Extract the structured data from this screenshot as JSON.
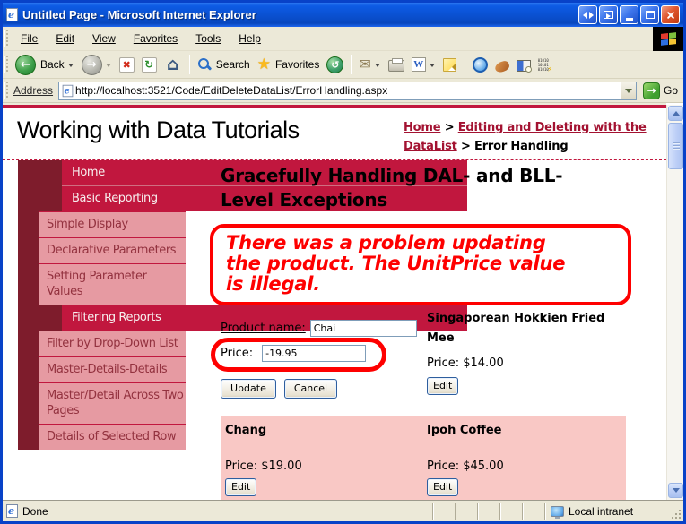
{
  "colors": {
    "crimson": "#C1173E",
    "maroon": "#7E1C2C",
    "side-pink": "#E69AA2",
    "side-sub-text": "#93323F",
    "row-pink": "#F9C8C5",
    "annotation-red": "#FE0000",
    "link-maroon": "#A31231",
    "chrome-beige": "#ECE9D8",
    "xp-border-blue": "#0842C8"
  },
  "window": {
    "title": "Untitled Page - Microsoft Internet Explorer"
  },
  "menu": {
    "items": [
      "File",
      "Edit",
      "View",
      "Favorites",
      "Tools",
      "Help"
    ]
  },
  "toolbar": {
    "back": "Back",
    "search": "Search",
    "favorites": "Favorites"
  },
  "address": {
    "label": "Address",
    "url": "http://localhost:3521/Code/EditDeleteDataList/ErrorHandling.aspx",
    "go": "Go"
  },
  "header": {
    "title": "Working with Data Tutorials",
    "breadcrumb": {
      "home": "Home",
      "sep1": " > ",
      "section": "Editing and Deleting with the DataList",
      "sep2": " > ",
      "current": "Error Handling"
    }
  },
  "sidebar": {
    "items": [
      {
        "label": "Home",
        "type": "main"
      },
      {
        "label": "Basic Reporting",
        "type": "main"
      },
      {
        "label": "Simple Display",
        "type": "sub"
      },
      {
        "label": "Declarative Parameters",
        "type": "sub"
      },
      {
        "label": "Setting Parameter Values",
        "type": "sub"
      },
      {
        "label": "Filtering Reports",
        "type": "main"
      },
      {
        "label": "Filter by Drop-Down List",
        "type": "sub"
      },
      {
        "label": "Master-Details-Details",
        "type": "sub"
      },
      {
        "label": "Master/Detail Across Two Pages",
        "type": "sub"
      },
      {
        "label": "Details of Selected Row",
        "type": "sub"
      }
    ]
  },
  "main": {
    "heading": "Gracefully Handling DAL- and BLL-Level Exceptions",
    "error_message": "There was a problem updating\nthe product. The UnitPrice value\nis illegal.",
    "form": {
      "product_name_label": "Product name:",
      "product_name_value": "Chai",
      "price_label": "Price:",
      "price_value": "-19.95",
      "update": "Update",
      "cancel": "Cancel"
    },
    "products": [
      {
        "name": "Singaporean Hokkien Fried Mee",
        "price": "Price: $14.00",
        "edit": "Edit"
      },
      {
        "name": "Chang",
        "price": "Price: $19.00",
        "edit": "Edit"
      },
      {
        "name": "Ipoh Coffee",
        "price": "Price: $45.00",
        "edit": "Edit"
      }
    ]
  },
  "statusbar": {
    "status": "Done",
    "zone": "Local intranet"
  }
}
